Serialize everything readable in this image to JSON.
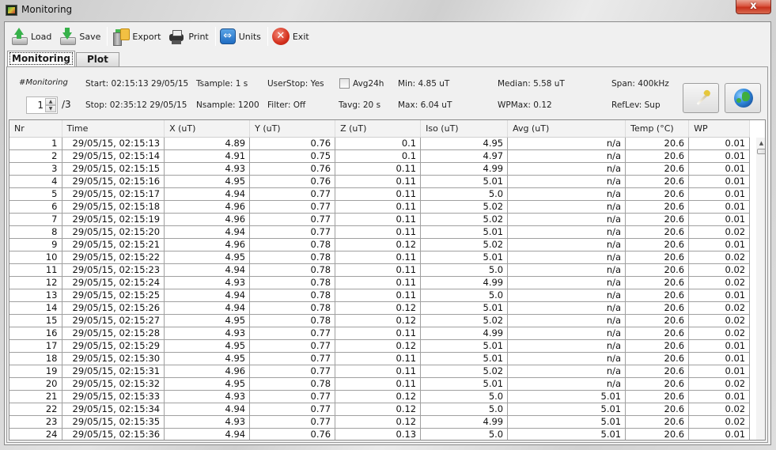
{
  "window": {
    "title": "Monitoring",
    "close_label": "x"
  },
  "toolbar": {
    "items": [
      {
        "label": "Load",
        "icon": "load-icon"
      },
      {
        "label": "Save",
        "icon": "save-icon"
      },
      {
        "label": "Export",
        "icon": "export-icon"
      },
      {
        "label": "Print",
        "icon": "print-icon"
      },
      {
        "label": "Units",
        "icon": "units-icon"
      },
      {
        "label": "Exit",
        "icon": "exit-icon"
      }
    ]
  },
  "tabs": [
    {
      "label": "Monitoring",
      "active": true
    },
    {
      "label": "Plot",
      "active": false
    }
  ],
  "info": {
    "tag": "#Monitoring",
    "page_value": "1",
    "page_total": "/3",
    "start": "Start: 02:15:13  29/05/15",
    "stop": "Stop: 02:35:12  29/05/15",
    "tsample": "Tsample: 1 s",
    "nsample": "Nsample: 1200",
    "userstop": "UserStop: Yes",
    "filter": "Filter: Off",
    "avg24h_label": "Avg24h",
    "avg24h_checked": false,
    "tavg": "Tavg: 20 s",
    "min": "Min: 4.85 uT",
    "max": "Max: 6.04 uT",
    "median": "Median: 5.58 uT",
    "wpmax": "WPMax: 0.12",
    "span": "Span: 400kHz",
    "reflev": "RefLev: Sup"
  },
  "table": {
    "columns": [
      "Nr",
      "Time",
      "X (uT)",
      "Y (uT)",
      "Z (uT)",
      "Iso (uT)",
      "Avg (uT)",
      "Temp (°C)",
      "WP"
    ],
    "rows": [
      [
        "1",
        "29/05/15, 02:15:13",
        "4.89",
        "0.76",
        "0.1",
        "4.95",
        "n/a",
        "20.6",
        "0.01"
      ],
      [
        "2",
        "29/05/15, 02:15:14",
        "4.91",
        "0.75",
        "0.1",
        "4.97",
        "n/a",
        "20.6",
        "0.01"
      ],
      [
        "3",
        "29/05/15, 02:15:15",
        "4.93",
        "0.76",
        "0.11",
        "4.99",
        "n/a",
        "20.6",
        "0.01"
      ],
      [
        "4",
        "29/05/15, 02:15:16",
        "4.95",
        "0.76",
        "0.11",
        "5.01",
        "n/a",
        "20.6",
        "0.01"
      ],
      [
        "5",
        "29/05/15, 02:15:17",
        "4.94",
        "0.77",
        "0.11",
        "5.0",
        "n/a",
        "20.6",
        "0.01"
      ],
      [
        "6",
        "29/05/15, 02:15:18",
        "4.96",
        "0.77",
        "0.11",
        "5.02",
        "n/a",
        "20.6",
        "0.01"
      ],
      [
        "7",
        "29/05/15, 02:15:19",
        "4.96",
        "0.77",
        "0.11",
        "5.02",
        "n/a",
        "20.6",
        "0.01"
      ],
      [
        "8",
        "29/05/15, 02:15:20",
        "4.94",
        "0.77",
        "0.11",
        "5.01",
        "n/a",
        "20.6",
        "0.02"
      ],
      [
        "9",
        "29/05/15, 02:15:21",
        "4.96",
        "0.78",
        "0.12",
        "5.02",
        "n/a",
        "20.6",
        "0.01"
      ],
      [
        "10",
        "29/05/15, 02:15:22",
        "4.95",
        "0.78",
        "0.11",
        "5.01",
        "n/a",
        "20.6",
        "0.02"
      ],
      [
        "11",
        "29/05/15, 02:15:23",
        "4.94",
        "0.78",
        "0.11",
        "5.0",
        "n/a",
        "20.6",
        "0.02"
      ],
      [
        "12",
        "29/05/15, 02:15:24",
        "4.93",
        "0.78",
        "0.11",
        "4.99",
        "n/a",
        "20.6",
        "0.02"
      ],
      [
        "13",
        "29/05/15, 02:15:25",
        "4.94",
        "0.78",
        "0.11",
        "5.0",
        "n/a",
        "20.6",
        "0.01"
      ],
      [
        "14",
        "29/05/15, 02:15:26",
        "4.94",
        "0.78",
        "0.12",
        "5.01",
        "n/a",
        "20.6",
        "0.02"
      ],
      [
        "15",
        "29/05/15, 02:15:27",
        "4.95",
        "0.78",
        "0.12",
        "5.02",
        "n/a",
        "20.6",
        "0.02"
      ],
      [
        "16",
        "29/05/15, 02:15:28",
        "4.93",
        "0.77",
        "0.11",
        "4.99",
        "n/a",
        "20.6",
        "0.02"
      ],
      [
        "17",
        "29/05/15, 02:15:29",
        "4.95",
        "0.77",
        "0.12",
        "5.01",
        "n/a",
        "20.6",
        "0.01"
      ],
      [
        "18",
        "29/05/15, 02:15:30",
        "4.95",
        "0.77",
        "0.11",
        "5.01",
        "n/a",
        "20.6",
        "0.01"
      ],
      [
        "19",
        "29/05/15, 02:15:31",
        "4.96",
        "0.77",
        "0.11",
        "5.02",
        "n/a",
        "20.6",
        "0.01"
      ],
      [
        "20",
        "29/05/15, 02:15:32",
        "4.95",
        "0.78",
        "0.11",
        "5.01",
        "n/a",
        "20.6",
        "0.02"
      ],
      [
        "21",
        "29/05/15, 02:15:33",
        "4.93",
        "0.77",
        "0.12",
        "5.0",
        "5.01",
        "20.6",
        "0.01"
      ],
      [
        "22",
        "29/05/15, 02:15:34",
        "4.94",
        "0.77",
        "0.12",
        "5.0",
        "5.01",
        "20.6",
        "0.02"
      ],
      [
        "23",
        "29/05/15, 02:15:35",
        "4.93",
        "0.77",
        "0.12",
        "4.99",
        "5.01",
        "20.6",
        "0.02"
      ],
      [
        "24",
        "29/05/15, 02:15:36",
        "4.94",
        "0.76",
        "0.13",
        "5.0",
        "5.01",
        "20.6",
        "0.01"
      ]
    ]
  }
}
